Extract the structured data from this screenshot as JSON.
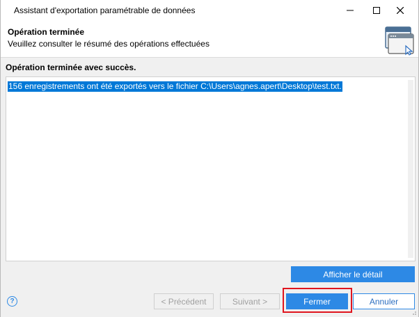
{
  "window": {
    "title": "Assistant d'exportation paramétrable de données",
    "minimize_icon": "minimize-icon",
    "maximize_icon": "maximize-icon",
    "close_icon": "close-icon"
  },
  "header": {
    "title": "Opération terminée",
    "subtitle": "Veuillez consulter le résumé des opérations effectuées",
    "icon": "wizard-window-icon"
  },
  "main": {
    "status_text": "Opération terminée avec succès.",
    "result_lines": [
      "156 enregistrements ont été exportés vers le fichier C:\\Users\\agnes.apert\\Desktop\\test.txt."
    ],
    "details_button": "Afficher le détail"
  },
  "footer": {
    "help_icon": "help-icon",
    "previous_button": "< Précédent",
    "next_button": "Suivant >",
    "close_button": "Fermer",
    "cancel_button": "Annuler"
  },
  "colors": {
    "accent": "#2d89e5",
    "selection": "#0078d7",
    "highlight_frame": "#e0151e"
  }
}
